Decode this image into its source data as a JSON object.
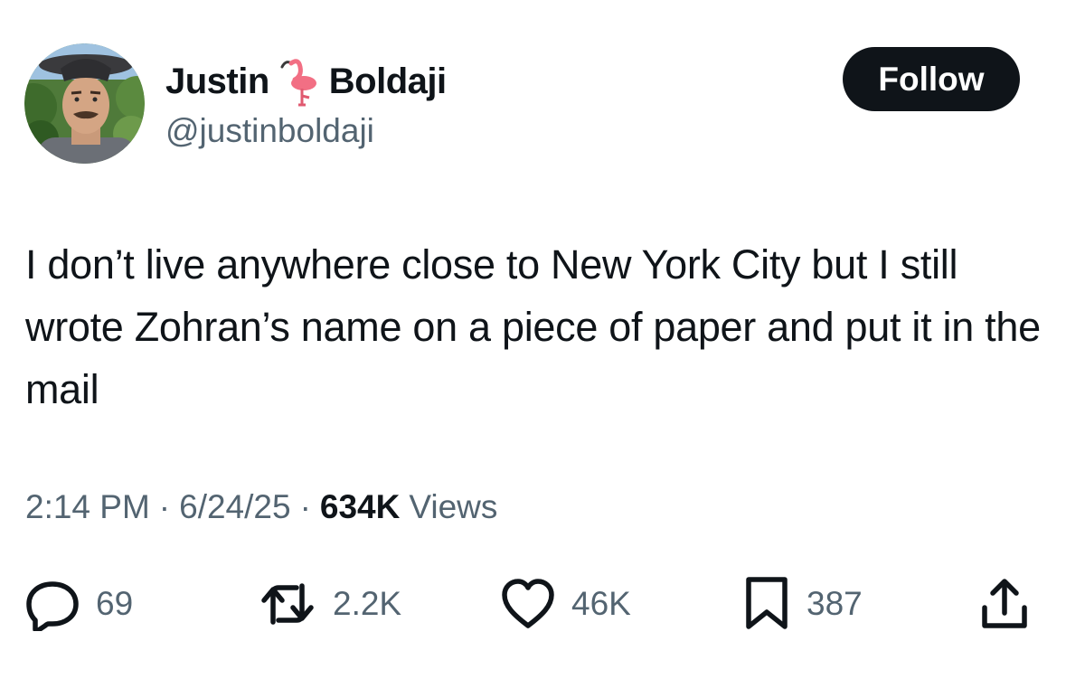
{
  "author": {
    "first_name": "Justin",
    "last_name": "Boldaji",
    "handle": "@justinboldaji",
    "name_emoji": "flamingo-emoji"
  },
  "follow_button": {
    "label": "Follow"
  },
  "tweet": {
    "text": "I don’t live anywhere close to New York City but I still wrote Zohran’s name on a piece of paper and put it in the mail",
    "time": "2:14 PM",
    "separator": "·",
    "date": "6/24/25",
    "views_count": "634K",
    "views_label": "Views"
  },
  "actions": {
    "replies": {
      "icon": "reply-icon",
      "count": "69"
    },
    "reposts": {
      "icon": "retweet-icon",
      "count": "2.2K"
    },
    "likes": {
      "icon": "heart-icon",
      "count": "46K"
    },
    "bookmarks": {
      "icon": "bookmark-icon",
      "count": "387"
    },
    "share": {
      "icon": "share-icon"
    }
  },
  "colors": {
    "text_primary": "#0f1419",
    "text_secondary": "#536471",
    "button_bg": "#0f1419",
    "button_text": "#ffffff",
    "flamingo": "#f26f84"
  }
}
